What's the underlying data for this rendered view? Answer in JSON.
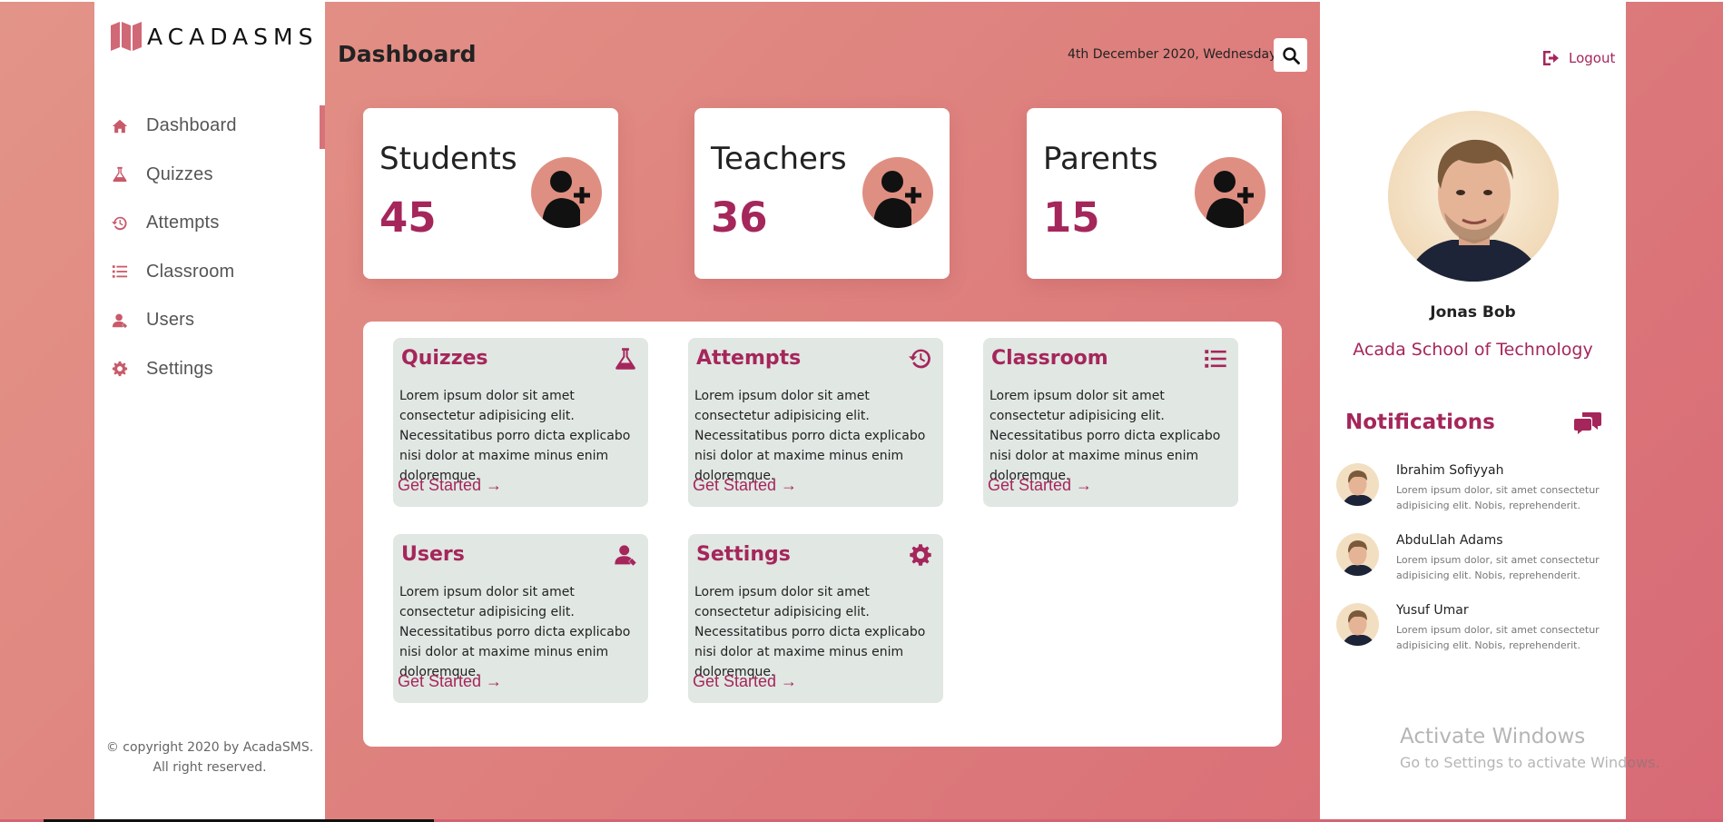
{
  "app": {
    "brand": "ACADASMS",
    "copyright": "© copyright 2020 by AcadaSMS. All right reserved."
  },
  "sidebar": {
    "items": [
      {
        "label": "Dashboard",
        "icon": "home-icon",
        "active": true
      },
      {
        "label": "Quizzes",
        "icon": "flask-icon",
        "active": false
      },
      {
        "label": "Attempts",
        "icon": "history-icon",
        "active": false
      },
      {
        "label": "Classroom",
        "icon": "list-icon",
        "active": false
      },
      {
        "label": "Users",
        "icon": "user-icon",
        "active": false
      },
      {
        "label": "Settings",
        "icon": "gear-icon",
        "active": false
      }
    ]
  },
  "header": {
    "title": "Dashboard",
    "date": "4th December 2020, Wednesday",
    "search_icon": "search-icon"
  },
  "stats": [
    {
      "label": "Students",
      "value": "45",
      "icon": "add-user-icon"
    },
    {
      "label": "Teachers",
      "value": "36",
      "icon": "add-user-icon"
    },
    {
      "label": "Parents",
      "value": "15",
      "icon": "add-user-icon"
    }
  ],
  "modules": [
    {
      "title": "Quizzes",
      "icon": "flask-icon",
      "text": "Lorem ipsum dolor sit amet consectetur adipisicing elit. Necessitatibus porro dicta explicabo nisi dolor at maxime minus enim doloremque.",
      "link": "Get Started →"
    },
    {
      "title": "Attempts",
      "icon": "history-icon",
      "text": "Lorem ipsum dolor sit amet consectetur adipisicing elit. Necessitatibus porro dicta explicabo nisi dolor at maxime minus enim doloremque.",
      "link": "Get Started →"
    },
    {
      "title": "Classroom",
      "icon": "list-icon",
      "text": "Lorem ipsum dolor sit amet consectetur adipisicing elit. Necessitatibus porro dicta explicabo nisi dolor at maxime minus enim doloremque.",
      "link": "Get Started →"
    },
    {
      "title": "Users",
      "icon": "user-icon",
      "text": "Lorem ipsum dolor sit amet consectetur adipisicing elit. Necessitatibus porro dicta explicabo nisi dolor at maxime minus enim doloremque.",
      "link": "Get Started →"
    },
    {
      "title": "Settings",
      "icon": "gear-icon",
      "text": "Lorem ipsum dolor sit amet consectetur adipisicing elit. Necessitatibus porro dicta explicabo nisi dolor at maxime minus enim doloremque.",
      "link": "Get Started →"
    }
  ],
  "profile": {
    "logout_label": "Logout",
    "name": "Jonas Bob",
    "school": "Acada School of Technology"
  },
  "notifications": {
    "title": "Notifications",
    "items": [
      {
        "name": "Ibrahim Sofiyyah",
        "text": "Lorem ipsum dolor, sit amet consectetur adipisicing elit. Nobis, reprehenderit."
      },
      {
        "name": "AbduLlah Adams",
        "text": "Lorem ipsum dolor, sit amet consectetur adipisicing elit. Nobis, reprehenderit."
      },
      {
        "name": "Yusuf Umar",
        "text": "Lorem ipsum dolor, sit amet consectetur adipisicing elit. Nobis, reprehenderit."
      }
    ]
  },
  "watermark": {
    "line1": "Activate Windows",
    "line2": "Go to Settings to activate Windows."
  },
  "colors": {
    "accent": "#a5265b",
    "icon_pink": "#c85a6a",
    "background_start": "#e39488",
    "background_end": "#d76a76",
    "module_card": "#e1e7e3"
  }
}
